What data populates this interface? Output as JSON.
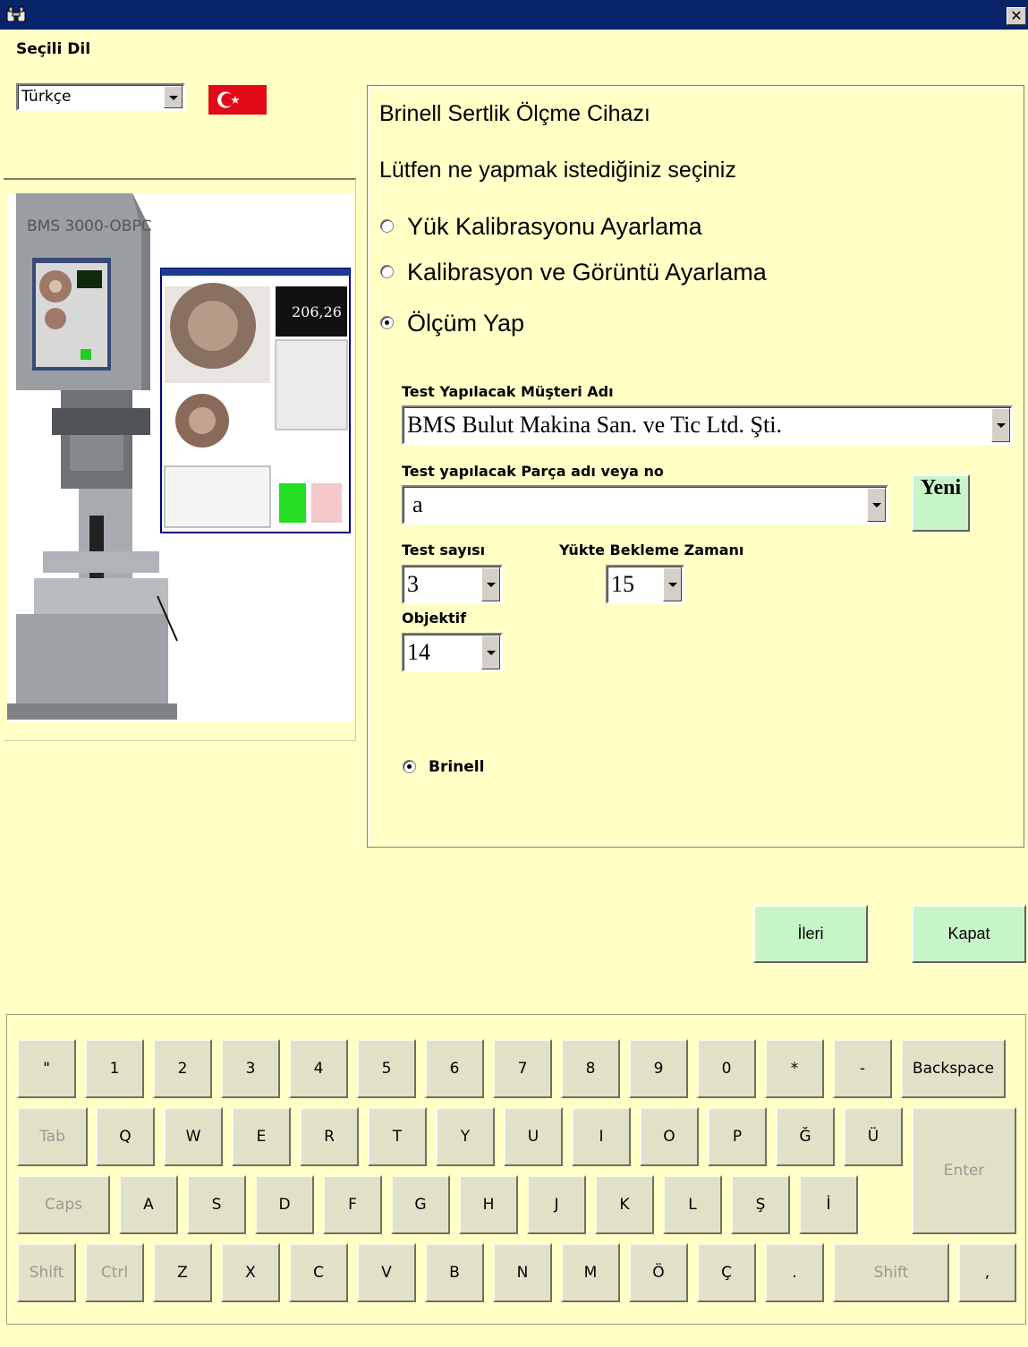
{
  "window": {
    "close_glyph": "✕"
  },
  "language": {
    "label": "Seçili Dil",
    "selected": "Türkçe",
    "flag": "turkey-flag"
  },
  "photo": {
    "model_label": "BMS 3000-OBPC",
    "reading": "206,26"
  },
  "panel": {
    "title": "Brinell Sertlik Ölçme Cihazı",
    "prompt": "Lütfen ne yapmak istediğiniz seçiniz",
    "options": [
      {
        "label": "Yük Kalibrasyonu Ayarlama",
        "selected": false
      },
      {
        "label": "Kalibrasyon ve Görüntü Ayarlama",
        "selected": false
      },
      {
        "label": "Ölçüm Yap",
        "selected": true
      }
    ],
    "customer": {
      "label": "Test Yapılacak Müşteri Adı",
      "value": "BMS Bulut Makina San. ve Tic Ltd. Şti."
    },
    "part": {
      "label": "Test yapılacak Parça adı veya no",
      "value": "a",
      "new_button": "Yeni"
    },
    "test_count": {
      "label": "Test sayısı",
      "value": "3"
    },
    "wait_time": {
      "label": "Yükte Bekleme Zamanı",
      "value": "15"
    },
    "objective": {
      "label": "Objektif",
      "value": "14"
    },
    "method": {
      "label": "Brinell",
      "selected": true
    }
  },
  "actions": {
    "next": "İleri",
    "close": "Kapat"
  },
  "keyboard": {
    "row1": [
      "\"",
      "1",
      "2",
      "3",
      "4",
      "5",
      "6",
      "7",
      "8",
      "9",
      "0",
      "*",
      "-"
    ],
    "backspace": "Backspace",
    "tab": "Tab",
    "row2": [
      "Q",
      "W",
      "E",
      "R",
      "T",
      "Y",
      "U",
      "I",
      "O",
      "P",
      "Ğ",
      "Ü"
    ],
    "enter": "Enter",
    "caps": "Caps",
    "row3": [
      "A",
      "S",
      "D",
      "F",
      "G",
      "H",
      "J",
      "K",
      "L",
      "Ş",
      "İ"
    ],
    "shift_left": "Shift",
    "ctrl": "Ctrl",
    "row4": [
      "Z",
      "X",
      "C",
      "V",
      "B",
      "N",
      "M",
      "Ö",
      "Ç",
      "."
    ],
    "shift_right": "Shift",
    "comma": ","
  }
}
